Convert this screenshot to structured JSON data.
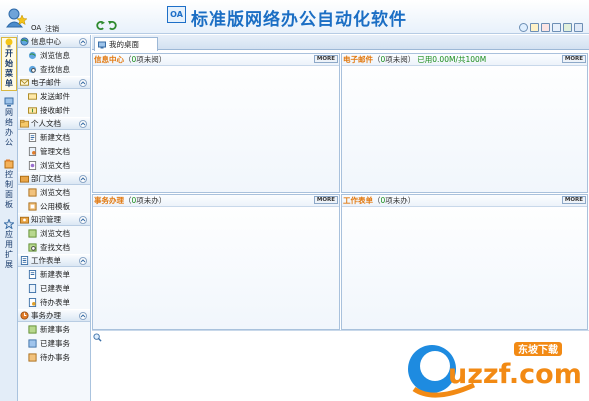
{
  "header": {
    "user_name": "OA",
    "logout_label": "注销",
    "logo_text": "OA",
    "app_title": "标准版网络办公自动化软件"
  },
  "vtabs": [
    {
      "chars": [
        "开",
        "始",
        "菜",
        "单"
      ],
      "active": true
    },
    {
      "chars": [
        "网",
        "络",
        "办",
        "公"
      ],
      "active": false
    },
    {
      "chars": [
        "控",
        "制",
        "面",
        "板"
      ],
      "active": false
    },
    {
      "chars": [
        "应",
        "用",
        "扩",
        "展"
      ],
      "active": false
    }
  ],
  "sidebar": {
    "sections": [
      {
        "label": "信息中心",
        "items": [
          "浏览信息",
          "查找信息"
        ]
      },
      {
        "label": "电子邮件",
        "items": [
          "发送邮件",
          "接收邮件"
        ]
      },
      {
        "label": "个人文档",
        "items": [
          "新建文档",
          "管理文档",
          "浏览文档"
        ]
      },
      {
        "label": "部门文档",
        "items": [
          "浏览文档",
          "公用模板"
        ]
      },
      {
        "label": "知识管理",
        "items": [
          "浏览文档",
          "查找文档"
        ]
      },
      {
        "label": "工作表单",
        "items": [
          "新建表单",
          "已建表单",
          "待办表单"
        ]
      },
      {
        "label": "事务办理",
        "items": [
          "新建事务",
          "已建事务",
          "待办事务"
        ]
      }
    ]
  },
  "tabs": {
    "desktop_label": "我的桌面"
  },
  "panels": {
    "info": {
      "title": "信息中心",
      "count_open": "（",
      "count": "0",
      "count_label": "项未阅）",
      "more": "MORE"
    },
    "mail": {
      "title": "电子邮件",
      "count_open": "（",
      "count": "0",
      "count_label": "项未阅）",
      "usage": "已用0.00M/共100M",
      "more": "MORE"
    },
    "affairs": {
      "title": "事务办理",
      "count_open": "（",
      "count": "0",
      "count_label": "项未办）",
      "more": "MORE"
    },
    "forms": {
      "title": "工作表单",
      "count_open": "（",
      "count": "0",
      "count_label": "项未办）",
      "more": "MORE"
    }
  },
  "watermark": {
    "brand": "uzzf.com",
    "tagline": "东坡下载"
  },
  "colors": {
    "accent": "#1b6ec4",
    "panel_title": "#e2780e",
    "count_green": "#1a8c1a"
  }
}
